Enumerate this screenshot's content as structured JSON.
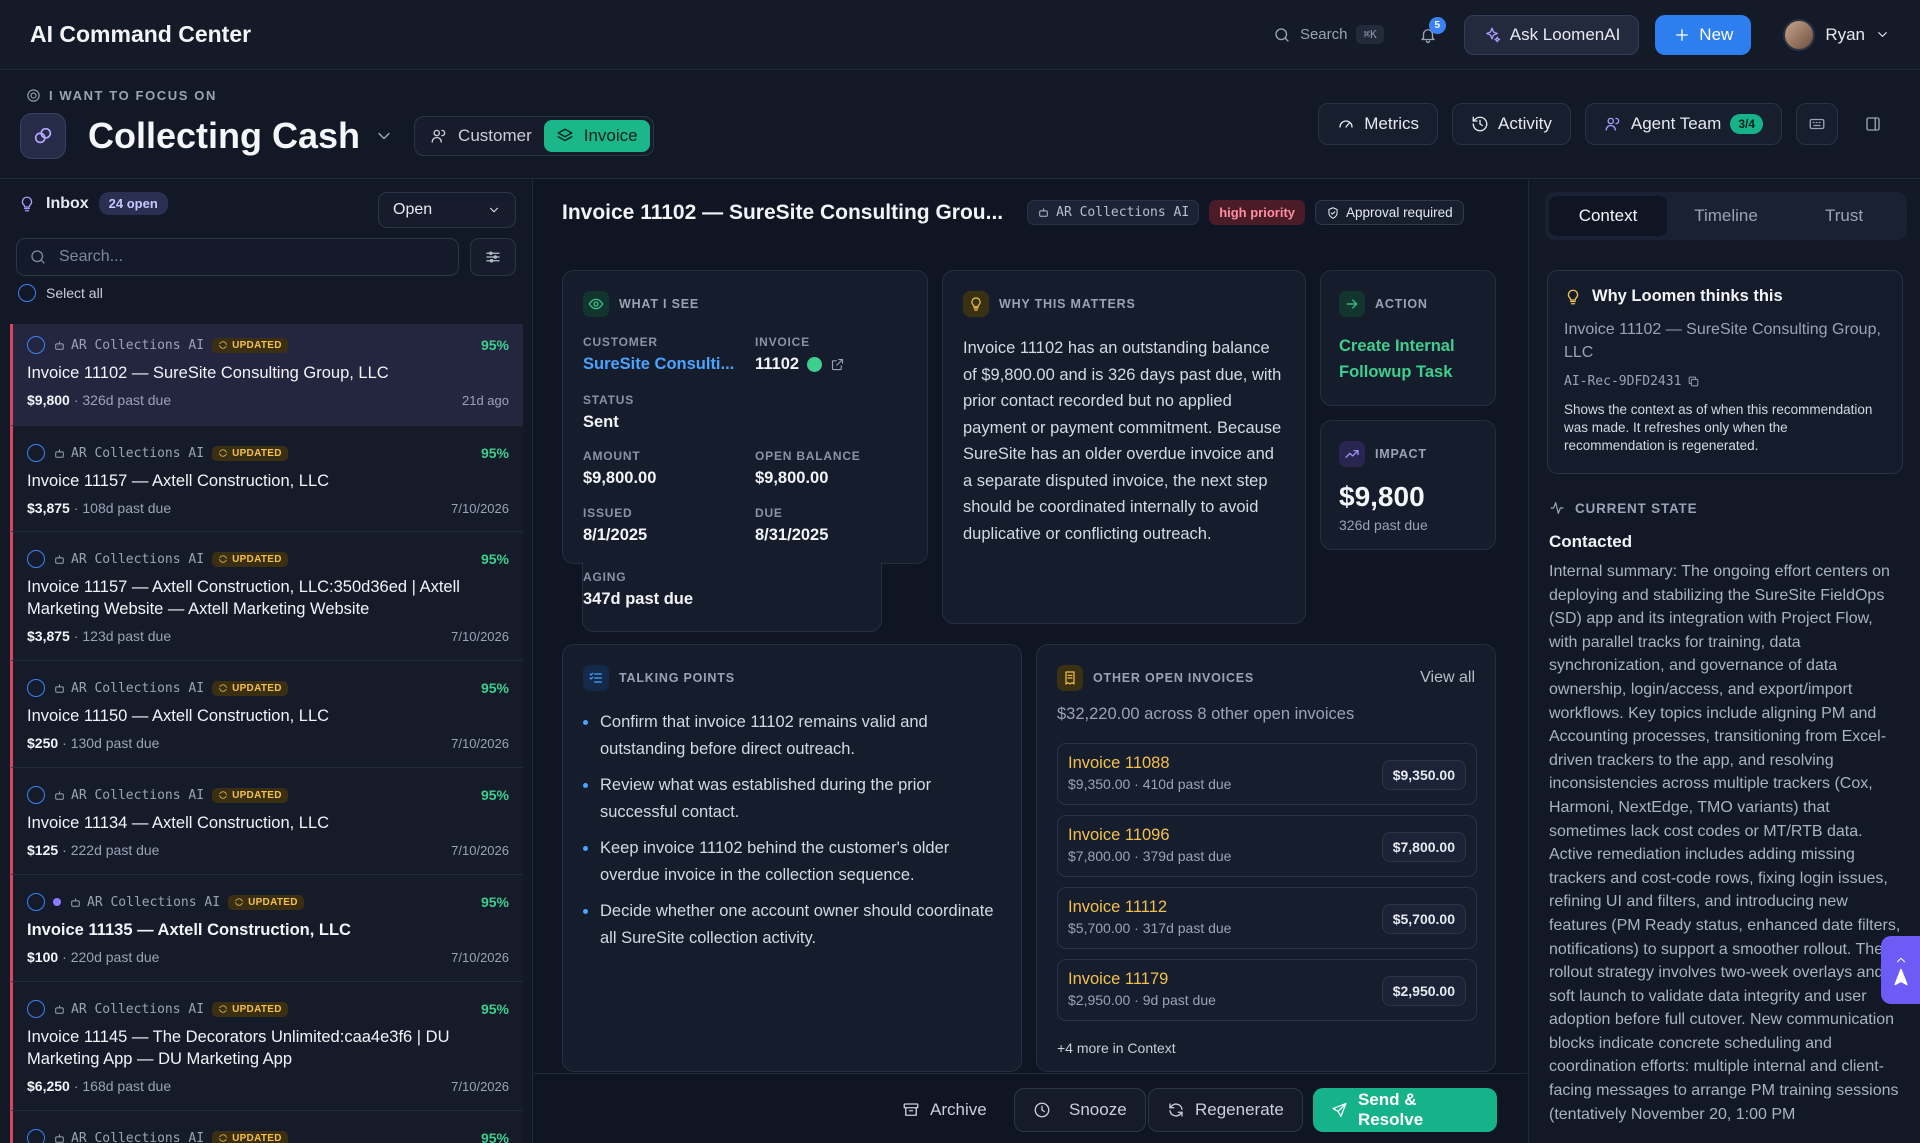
{
  "app": {
    "title": "AI Command Center"
  },
  "topbar": {
    "search_label": "Search",
    "search_kbd": "⌘K",
    "notif_count": "5",
    "ask_label": "Ask LoomenAI",
    "new_label": "New",
    "user_name": "Ryan"
  },
  "focus": {
    "label": "I WANT TO FOCUS ON",
    "title": "Collecting Cash",
    "seg_customer": "Customer",
    "seg_invoice": "Invoice"
  },
  "header_actions": {
    "metrics": "Metrics",
    "activity": "Activity",
    "agent_team": "Agent Team",
    "agent_count": "3/4"
  },
  "inbox": {
    "title": "Inbox",
    "count": "24 open",
    "filter_value": "Open",
    "search_placeholder": "Search...",
    "select_all": "Select all",
    "items": [
      {
        "agent": "AR Collections AI",
        "updated": "UPDATED",
        "pct": "95%",
        "title": "Invoice 11102 — SureSite Consulting Group, LLC",
        "amount": "$9,800",
        "due": "· 326d past due",
        "date": "21d ago"
      },
      {
        "agent": "AR Collections AI",
        "updated": "UPDATED",
        "pct": "95%",
        "title": "Invoice 11157 — Axtell Construction, LLC",
        "amount": "$3,875",
        "due": "· 108d past due",
        "date": "7/10/2026"
      },
      {
        "agent": "AR Collections AI",
        "updated": "UPDATED",
        "pct": "95%",
        "title": "Invoice 11157 — Axtell Construction, LLC:350d36ed | Axtell Marketing Website — Axtell Marketing Website",
        "amount": "$3,875",
        "due": "· 123d past due",
        "date": "7/10/2026"
      },
      {
        "agent": "AR Collections AI",
        "updated": "UPDATED",
        "pct": "95%",
        "title": "Invoice 11150 — Axtell Construction, LLC",
        "amount": "$250",
        "due": "· 130d past due",
        "date": "7/10/2026"
      },
      {
        "agent": "AR Collections AI",
        "updated": "UPDATED",
        "pct": "95%",
        "title": "Invoice 11134 — Axtell Construction, LLC",
        "amount": "$125",
        "due": "· 222d past due",
        "date": "7/10/2026"
      },
      {
        "agent": "AR Collections AI",
        "updated": "UPDATED",
        "pct": "95%",
        "title": "Invoice 11135 — Axtell Construction, LLC",
        "amount": "$100",
        "due": "· 220d past due",
        "date": "7/10/2026"
      },
      {
        "agent": "AR Collections AI",
        "updated": "UPDATED",
        "pct": "95%",
        "title": "Invoice 11145 — The Decorators Unlimited:caa4e3f6 | DU Marketing App — DU Marketing App",
        "amount": "$6,250",
        "due": "· 168d past due",
        "date": "7/10/2026"
      },
      {
        "agent": "AR Collections AI",
        "updated": "UPDATED",
        "pct": "95%",
        "title": "",
        "amount": "",
        "due": "",
        "date": ""
      }
    ]
  },
  "detail": {
    "title": "Invoice 11102 — SureSite Consulting Grou...",
    "agent_tag": "AR Collections AI",
    "priority": "high priority",
    "approval": "Approval required",
    "what_i_see": {
      "heading": "WHAT I SEE",
      "customer_label": "CUSTOMER",
      "customer_value": "SureSite Consulti...",
      "invoice_label": "INVOICE",
      "invoice_value": "11102",
      "status_label": "STATUS",
      "status_value": "Sent",
      "amount_label": "AMOUNT",
      "amount_value": "$9,800.00",
      "open_label": "OPEN BALANCE",
      "open_value": "$9,800.00",
      "issued_label": "ISSUED",
      "issued_value": "8/1/2025",
      "due_label": "DUE",
      "due_value": "8/31/2025",
      "aging_label": "AGING",
      "aging_value": "347d past due"
    },
    "why_matters": {
      "heading": "WHY THIS MATTERS",
      "text": "Invoice 11102 has an outstanding balance of $9,800.00 and is 326 days past due, with prior contact recorded but no applied payment or payment commitment. Because SureSite has an older overdue invoice and a separate disputed invoice, the next step should be coordinated internally to avoid duplicative or conflicting outreach."
    },
    "action": {
      "heading": "ACTION",
      "link": "Create Internal Followup Task"
    },
    "impact": {
      "heading": "IMPACT",
      "value": "$9,800",
      "sub": "326d past due"
    },
    "talking_points": {
      "heading": "TALKING POINTS",
      "items": [
        "Confirm that invoice 11102 remains valid and outstanding before direct outreach.",
        "Review what was established during the prior successful contact.",
        "Keep invoice 11102 behind the customer's older overdue invoice in the collection sequence.",
        "Decide whether one account owner should coordinate all SureSite collection activity."
      ]
    },
    "other_open": {
      "heading": "OTHER OPEN INVOICES",
      "view_all": "View all",
      "summary": "$32,220.00 across 8 other open invoices",
      "items": [
        {
          "name": "Invoice 11088",
          "sub": "$9,350.00 · 410d past due",
          "amount": "$9,350.00"
        },
        {
          "name": "Invoice 11096",
          "sub": "$7,800.00 · 379d past due",
          "amount": "$7,800.00"
        },
        {
          "name": "Invoice 11112",
          "sub": "$5,700.00 · 317d past due",
          "amount": "$5,700.00"
        },
        {
          "name": "Invoice 11179",
          "sub": "$2,950.00 · 9d past due",
          "amount": "$2,950.00"
        }
      ],
      "more": "+4 more in Context"
    },
    "bottom": {
      "archive": "Archive",
      "snooze": "Snooze",
      "regenerate": "Regenerate",
      "send": "Send & Resolve"
    }
  },
  "context": {
    "tabs": [
      "Context",
      "Timeline",
      "Trust"
    ],
    "why": {
      "heading": "Why Loomen thinks this",
      "text": "Invoice 11102 — SureSite Consulting Group, LLC",
      "id": "AI-Rec-9DFD2431",
      "note": "Shows the context as of when this recommendation was made. It refreshes only when the recommendation is regenerated."
    },
    "current_state": {
      "heading": "CURRENT STATE",
      "state": "Contacted",
      "body": "Internal summary: The ongoing effort centers on deploying and stabilizing the SureSite FieldOps (SD) app and its integration with Project Flow, with parallel tracks for training, data synchronization, and governance of data ownership, login/access, and export/import workflows. Key topics include aligning PM and Accounting processes, transitioning from Excel-driven trackers to the app, and resolving inconsistencies across multiple trackers (Cox, Harmoni, NextEdge, TMO variants) that sometimes lack cost codes or MT/RTB data. Active remediation includes adding missing trackers and cost-code rows, fixing login issues, refining UI and filters, and introducing new features (PM Ready status, enhanced date filters, notifications) to support a smoother rollout. The rollout strategy involves two-week overlays and soft launch to validate data integrity and user adoption before full cutover. New communication blocks indicate concrete scheduling and coordination efforts: multiple internal and client-facing messages to arrange PM training sessions (tentatively November 20, 1:00 PM"
    }
  }
}
